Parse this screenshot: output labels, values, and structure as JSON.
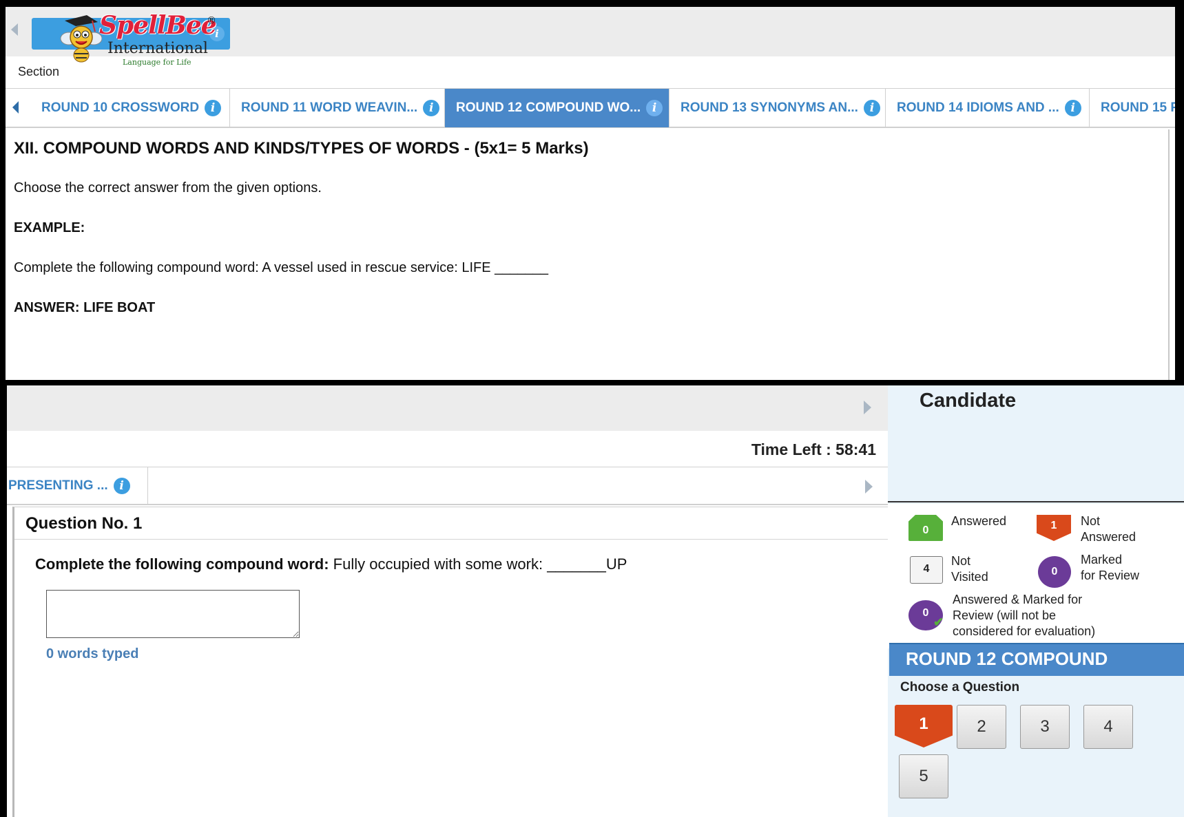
{
  "logo": {
    "brand": "SpellBee",
    "registered": "®",
    "subtitle": "International",
    "tagline": "Language for Life"
  },
  "section_label": "Section",
  "section_tabs": [
    {
      "label": "ROUND 10 CROSSWORD",
      "active": false
    },
    {
      "label": "ROUND 11 WORD WEAVIN...",
      "active": false
    },
    {
      "label": "ROUND 12 COMPOUND WO...",
      "active": true
    },
    {
      "label": "ROUND 13 SYNONYMS AN...",
      "active": false
    },
    {
      "label": "ROUND 14 IDIOMS AND ...",
      "active": false
    },
    {
      "label": "ROUND 15 P",
      "active": false
    }
  ],
  "instructions": {
    "title": "XII. COMPOUND WORDS AND KINDS/TYPES OF WORDS - (5x1= 5 Marks)",
    "line1": "Choose the correct answer from the given options.",
    "example_label": "EXAMPLE:",
    "example_text": "Complete the following compound word: A vessel used in rescue service: LIFE _______",
    "answer": "ANSWER: LIFE BOAT"
  },
  "timer": {
    "text": "Time Left : 58:41"
  },
  "bottom_tab": {
    "label": "PRESENTING ..."
  },
  "question": {
    "number_label": "Question No. 1",
    "prompt_bold": "Complete the following compound word:",
    "prompt_rest": " Fully occupied with some work: _______UP",
    "answer_value": "",
    "words_typed": "0 words typed"
  },
  "candidate": {
    "label": "Candidate"
  },
  "legend": {
    "answered": {
      "count": "0",
      "label": "Answered"
    },
    "not_answered": {
      "count": "1",
      "label_line1": "Not",
      "label_line2": "Answered"
    },
    "not_visited": {
      "count": "4",
      "label_line1": "Not",
      "label_line2": "Visited"
    },
    "marked": {
      "count": "0",
      "label_line1": "Marked",
      "label_line2": "for Review"
    },
    "answered_marked": {
      "count": "0",
      "label_line1": "Answered & Marked for",
      "label_line2": "Review (will not be",
      "label_line3": "considered for evaluation)"
    }
  },
  "palette": {
    "round_title": "ROUND 12 COMPOUND",
    "choose_label": "Choose a Question",
    "questions": [
      "1",
      "2",
      "3",
      "4",
      "5"
    ]
  },
  "colors": {
    "accent_blue": "#4a88c9",
    "link_blue": "#3b84c4",
    "answered_green": "#57b03a",
    "not_answered_red": "#d9491b",
    "marked_purple": "#6b3b98"
  }
}
